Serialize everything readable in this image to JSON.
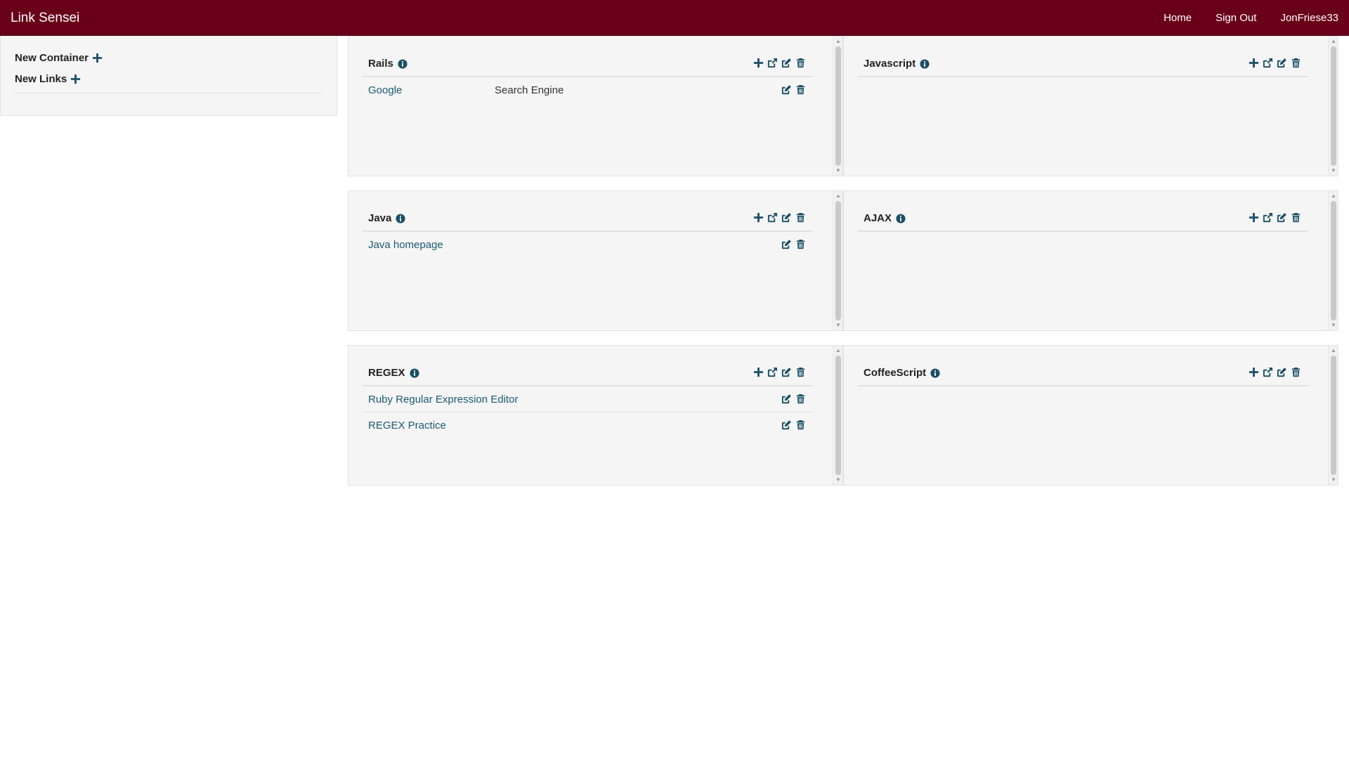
{
  "navbar": {
    "brand": "Link Sensei",
    "links": [
      "Home",
      "Sign Out",
      "JonFriese33"
    ]
  },
  "sidebar": {
    "items": [
      {
        "label": "New Container",
        "icon": "plus-icon"
      },
      {
        "label": "New Links",
        "icon": "plus-icon"
      }
    ]
  },
  "colors": {
    "navbar_bg": "#680019",
    "icon": "#1a4f66",
    "link": "#1a5a73",
    "panel_bg": "#f5f5f5"
  },
  "containers": [
    {
      "title": "Rails",
      "actions": [
        "plus-icon",
        "external-link-icon",
        "edit-icon",
        "trash-icon"
      ],
      "links": [
        {
          "name": "Google",
          "description": "Search Engine"
        }
      ]
    },
    {
      "title": "Javascript",
      "actions": [
        "plus-icon",
        "external-link-icon",
        "edit-icon",
        "trash-icon"
      ],
      "links": []
    },
    {
      "title": "Java",
      "actions": [
        "plus-icon",
        "external-link-icon",
        "edit-icon",
        "trash-icon"
      ],
      "links": [
        {
          "name": "Java homepage",
          "description": ""
        }
      ]
    },
    {
      "title": "AJAX",
      "actions": [
        "plus-icon",
        "external-link-icon",
        "edit-icon",
        "trash-icon"
      ],
      "links": []
    },
    {
      "title": "REGEX",
      "actions": [
        "plus-icon",
        "external-link-icon",
        "edit-icon",
        "trash-icon"
      ],
      "links": [
        {
          "name": "Ruby Regular Expression Editor",
          "description": ""
        },
        {
          "name": "REGEX Practice",
          "description": ""
        }
      ]
    },
    {
      "title": "CoffeeScript",
      "actions": [
        "plus-icon",
        "external-link-icon",
        "edit-icon",
        "trash-icon"
      ],
      "links": []
    }
  ]
}
